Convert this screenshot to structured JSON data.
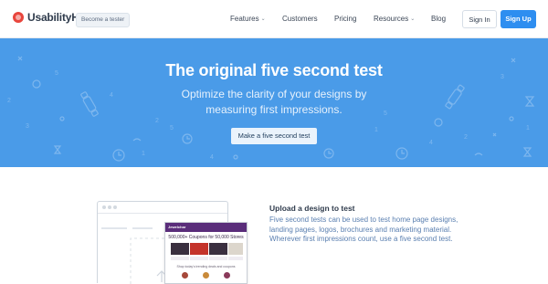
{
  "header": {
    "logo_text": "UsabilityHub",
    "tester_badge": "Become a tester",
    "nav": [
      {
        "label": "Features",
        "has_dropdown": true
      },
      {
        "label": "Customers",
        "has_dropdown": false
      },
      {
        "label": "Pricing",
        "has_dropdown": false
      },
      {
        "label": "Resources",
        "has_dropdown": true
      },
      {
        "label": "Blog",
        "has_dropdown": false
      }
    ],
    "signin_label": "Sign In",
    "signup_label": "Sign Up"
  },
  "hero": {
    "title": "The original five second test",
    "subtitle_line1": "Optimize the clarity of your designs by",
    "subtitle_line2": "measuring first impressions.",
    "cta_label": "Make a five second test"
  },
  "preview": {
    "brand": "Jewelchar",
    "headline": "500,000+ Coupons for 50,000 Stores",
    "caption": "Shop today's trending deals and coupons"
  },
  "feature": {
    "title": "Upload a design to test",
    "description": "Five second tests can be used to test home page designs, landing pages, logos, brochures and marketing material. Wherever first impressions count, use a five second test."
  },
  "colors": {
    "hero_bg": "#4a9be8",
    "signup_bg": "#2e8ef0",
    "logo_red": "#e8453c",
    "link_text": "#5a7fb0"
  },
  "icons": [
    "logo-mark-icon",
    "chevron-down-icon",
    "stopwatch-icon",
    "clock-icon",
    "hourglass-icon"
  ]
}
